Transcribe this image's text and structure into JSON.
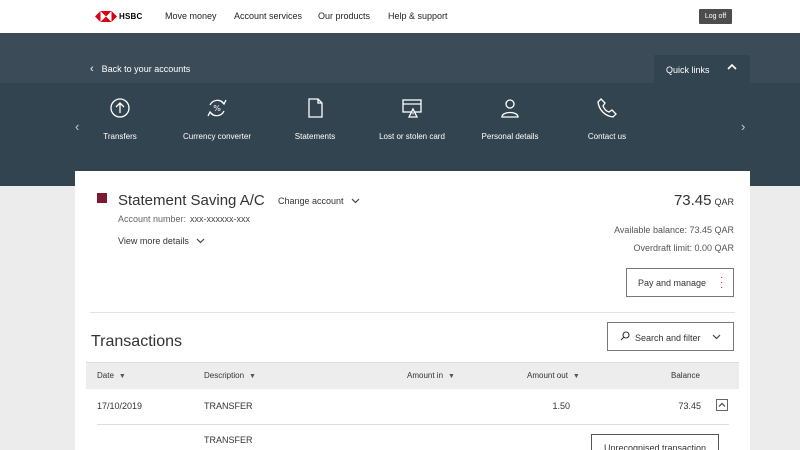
{
  "brand": {
    "name": "HSBC",
    "color": "#db0011"
  },
  "nav": {
    "items": [
      "Move money",
      "Account services",
      "Our products",
      "Help & support"
    ],
    "logoff": "Log off"
  },
  "header": {
    "back_label": "Back to your accounts",
    "quick_links_label": "Quick links",
    "quick_links": [
      {
        "label": "Transfers",
        "icon": "transfer-icon"
      },
      {
        "label": "Currency converter",
        "icon": "currency-converter-icon"
      },
      {
        "label": "Statements",
        "icon": "document-icon"
      },
      {
        "label": "Lost or stolen card",
        "icon": "card-warning-icon"
      },
      {
        "label": "Personal details",
        "icon": "person-icon"
      },
      {
        "label": "Contact us",
        "icon": "phone-icon"
      }
    ]
  },
  "account": {
    "name": "Statement Saving A/C",
    "change_label": "Change account",
    "number_label": "Account number:",
    "number": "xxx-xxxxxx-xxx",
    "view_more": "View more details",
    "balance": "73.45",
    "currency": "QAR",
    "available": "Available balance: 73.45 QAR",
    "overdraft": "Overdraft limit: 0.00 QAR",
    "pay_manage": "Pay and manage",
    "swatch_color": "#7a1a33"
  },
  "transactions": {
    "title": "Transactions",
    "search_filter": "Search and filter",
    "columns": [
      "Date",
      "Description",
      "Amount in",
      "Amount out",
      "Balance"
    ],
    "rows": [
      {
        "date": "17/10/2019",
        "description": "TRANSFER",
        "amount_in": "",
        "amount_out": "1.50",
        "balance": "73.45"
      }
    ],
    "expanded_description": "TRANSFER",
    "unrecognised": "Unrecognised transaction"
  }
}
